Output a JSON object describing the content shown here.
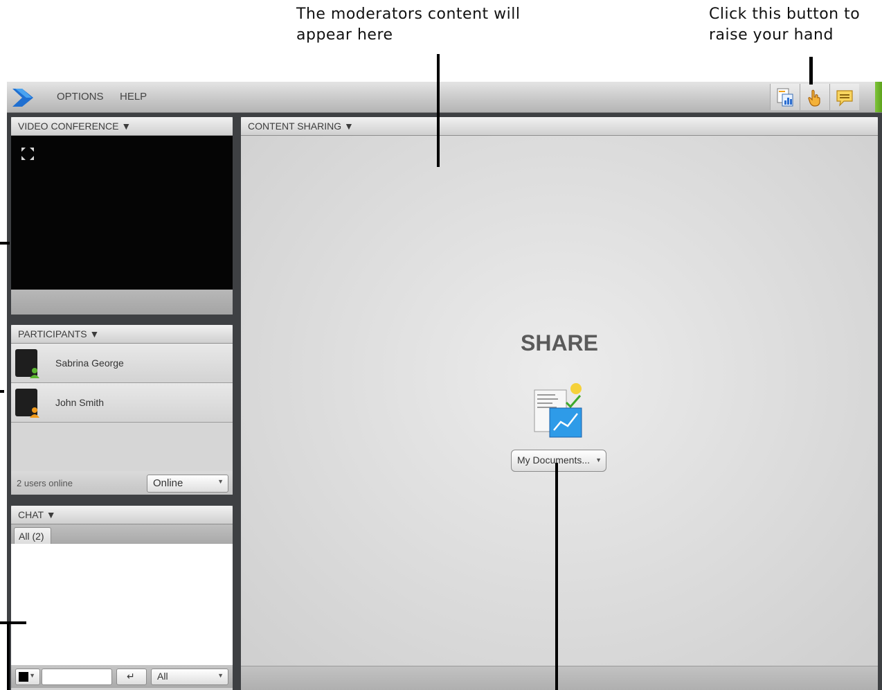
{
  "annotations": {
    "moderator_content": "The moderators content will\nappear here",
    "raise_hand": "Click this button to\nraise your hand"
  },
  "menubar": {
    "items": [
      "OPTIONS",
      "HELP"
    ],
    "toolbar_icons": [
      "presentation-icon",
      "raise-hand-icon",
      "chat-bubble-icon"
    ]
  },
  "video_panel": {
    "title": "VIDEO CONFERENCE ▼"
  },
  "participants_panel": {
    "title": "PARTICIPANTS ▼",
    "participants": [
      {
        "name": "Sabrina George",
        "status_color": "#5bb531"
      },
      {
        "name": "John Smith",
        "status_color": "#f09a1c"
      }
    ],
    "users_online": "2 users online",
    "status_select": "Online"
  },
  "chat_panel": {
    "title": "CHAT ▼",
    "tab": "All (2)",
    "recipient_select": "All"
  },
  "content_panel": {
    "title": "CONTENT SHARING ▼",
    "share_label": "SHARE",
    "documents_button": "My Documents..."
  },
  "colors": {
    "accent_green": "#6cb52a",
    "logo_blue": "#1f6fd1"
  }
}
